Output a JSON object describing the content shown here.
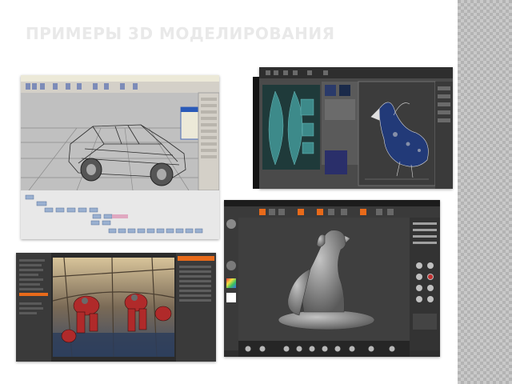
{
  "slide": {
    "title": "ПРИМЕРЫ 3D МОДЕЛИРОВАНИЯ"
  },
  "screenshots": [
    {
      "subject": "3ds Max car wireframe viewport"
    },
    {
      "subject": "UV unwrapping with creature model"
    },
    {
      "subject": "ZBrush dog sculpture"
    },
    {
      "subject": "Rendered robots in industrial hall"
    }
  ],
  "colors": {
    "title": "#e9e9e9",
    "band": "#b3b3b3",
    "panel_dark": "#3a3a3a",
    "accent_orange": "#e86a1a"
  }
}
